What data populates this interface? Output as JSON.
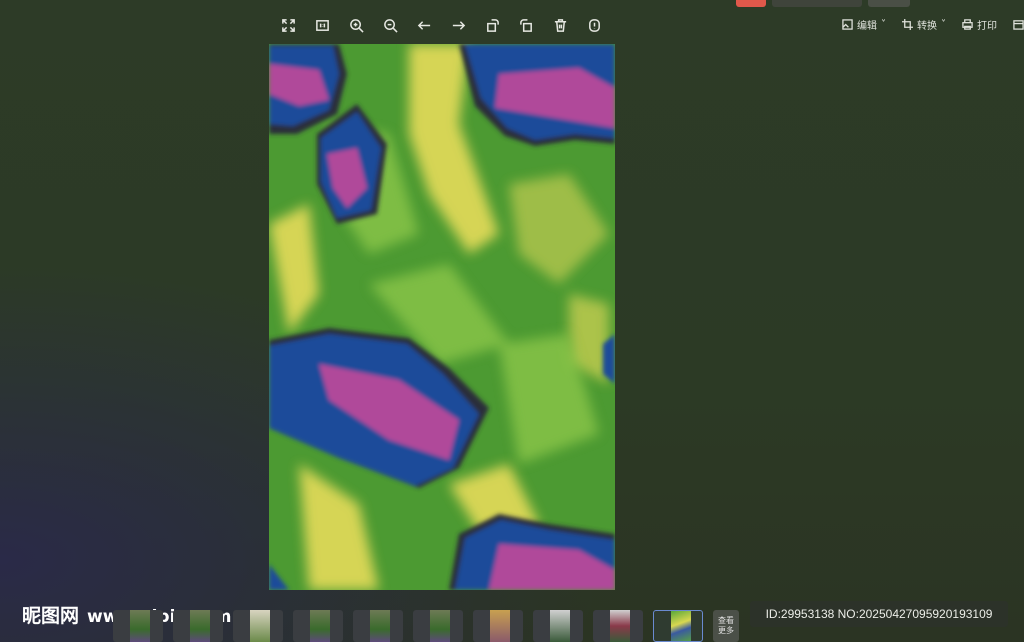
{
  "toolbar": {
    "tools": [
      "fullscreen-icon",
      "actual-size-icon",
      "zoom-in-icon",
      "zoom-out-icon",
      "previous-icon",
      "next-icon",
      "rotate-left-icon",
      "rotate-right-icon",
      "delete-icon",
      "info-icon"
    ]
  },
  "actions": {
    "edit": "编辑",
    "convert": "转换",
    "print": "打印"
  },
  "watermark": {
    "brand": "昵图网",
    "url": "www.nipic.com"
  },
  "filmstrip": {
    "more_label": "查看更多",
    "count": 10,
    "active_index": 9
  },
  "image_info": "ID:29953138 NO:20250427095920193109",
  "colors": {
    "green": "#4c9a32",
    "yellow": "#e6dc5a",
    "blue": "#1f4c9a",
    "magenta": "#b0489a"
  }
}
